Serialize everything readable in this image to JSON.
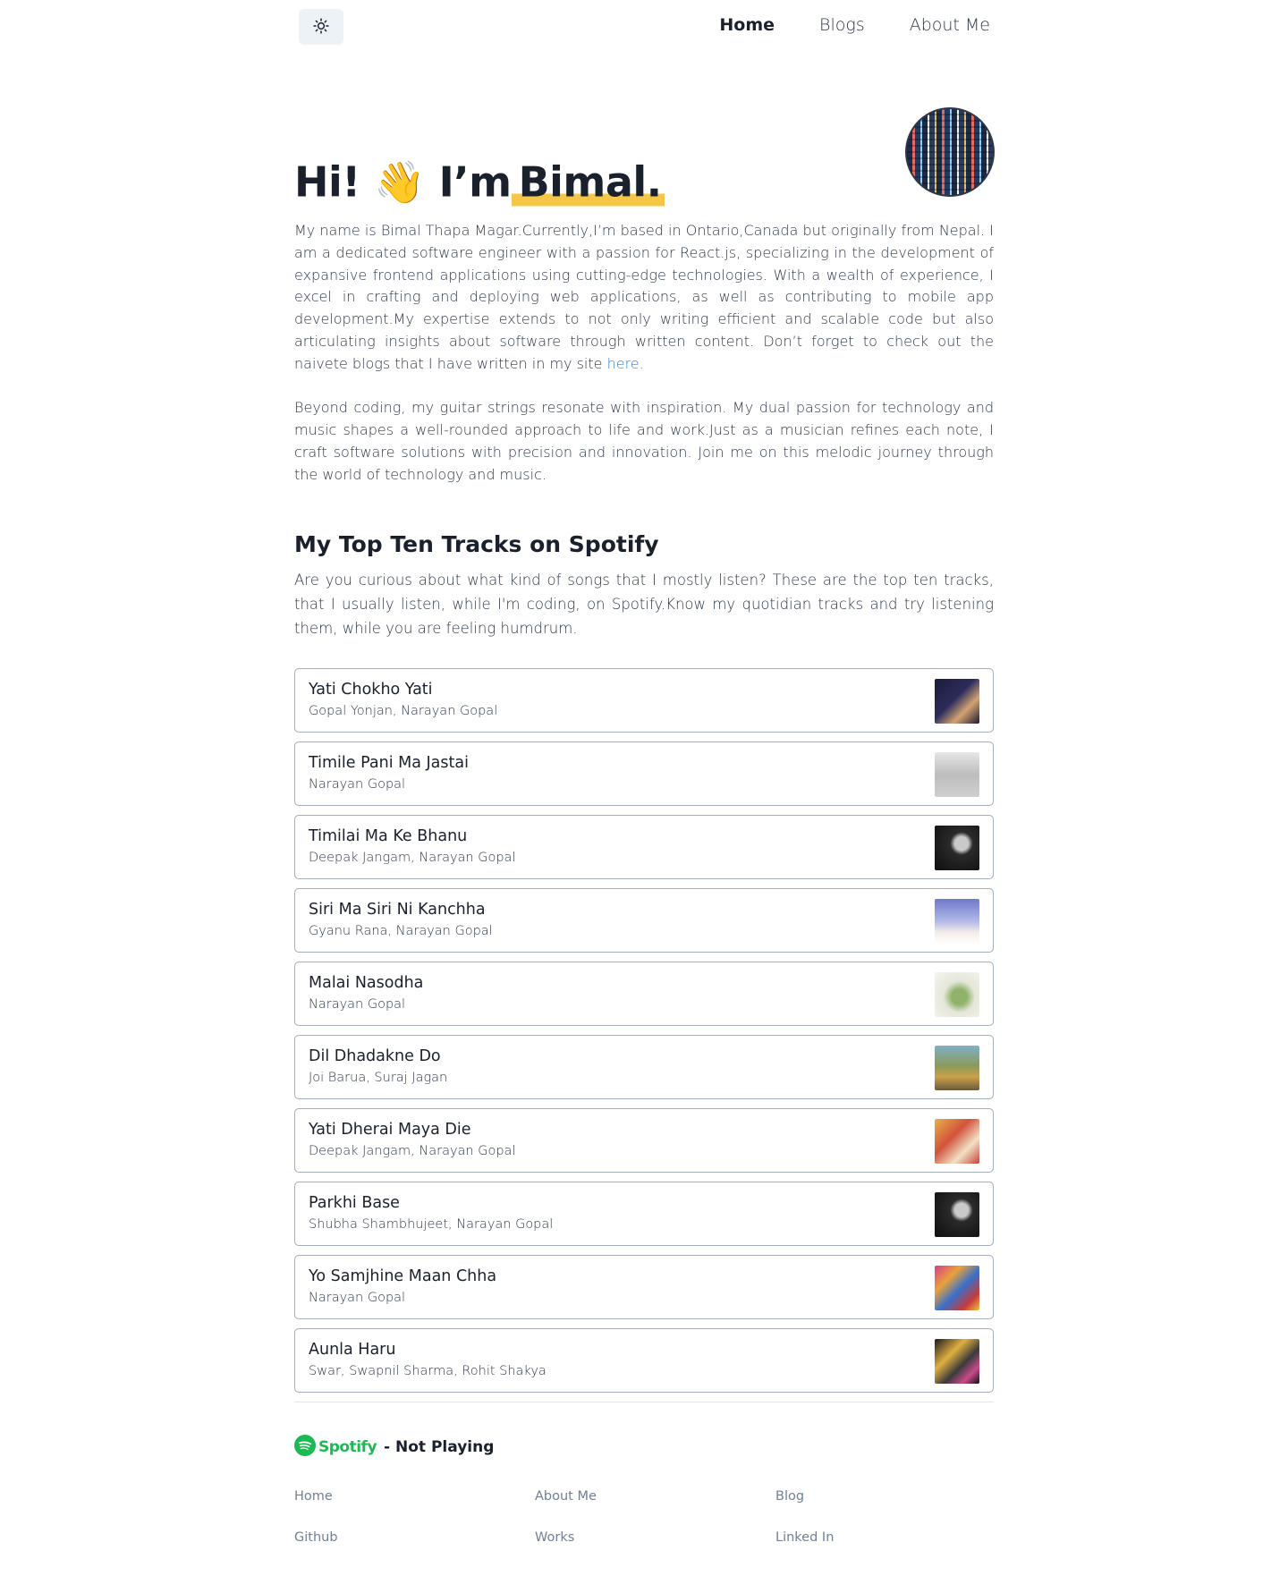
{
  "nav": {
    "theme_icon": "sun-icon",
    "links": [
      "Home",
      "Blogs",
      "About Me"
    ]
  },
  "hero": {
    "greeting": "Hi!",
    "wave": "👋",
    "im": "I’m",
    "name": "Bimal."
  },
  "about": {
    "p1_text": "My name is Bimal Thapa Magar.Currently,I’m based in Ontario,Canada but originally from Nepal. I am a dedicated software engineer with a passion for React.js, specializing in the development of expansive frontend applications using cutting-edge technologies. With a wealth of experience, I excel in crafting and deploying web applications, as well as contributing to mobile app development.My expertise extends to not only writing efficient and scalable code but also articulating insights about software through written content. Don’t forget to check out the naivete blogs that I have written in my site ",
    "p1_link": "here",
    "p1_end": ".",
    "p2": "Beyond coding, my guitar strings resonate with inspiration. My dual passion for technology and music shapes a well-rounded approach to life and work.Just as a musician refines each note, I craft software solutions with precision and innovation. Join me on this melodic journey through the world of technology and music."
  },
  "spotify_section": {
    "title": "My Top Ten Tracks on Spotify",
    "intro": "Are you curious about what kind of songs that I mostly listen? These are the top ten tracks, that I usually listen, while I'm coding, on Spotify.Know my quotidian tracks and try listening them, while you are feeling humdrum.",
    "tracks": [
      {
        "name": "Yati Chokho Yati",
        "artist": "Gopal Yonjan, Narayan Gopal"
      },
      {
        "name": "Timile Pani Ma Jastai",
        "artist": "Narayan Gopal"
      },
      {
        "name": "Timilai Ma Ke Bhanu",
        "artist": "Deepak Jangam, Narayan Gopal"
      },
      {
        "name": "Siri Ma Siri Ni Kanchha",
        "artist": "Gyanu Rana, Narayan Gopal"
      },
      {
        "name": "Malai Nasodha",
        "artist": "Narayan Gopal"
      },
      {
        "name": "Dil Dhadakne Do",
        "artist": "Joi Barua, Suraj Jagan"
      },
      {
        "name": "Yati Dherai Maya Die",
        "artist": "Deepak Jangam, Narayan Gopal"
      },
      {
        "name": "Parkhi Base",
        "artist": "Shubha Shambhujeet, Narayan Gopal"
      },
      {
        "name": "Yo Samjhine Maan Chha",
        "artist": "Narayan Gopal"
      },
      {
        "name": "Aunla Haru",
        "artist": "Swar, Swapnil Sharma, Rohit Shakya"
      }
    ]
  },
  "now_playing": {
    "brand": "Spotify",
    "status": "- Not Playing"
  },
  "footer": {
    "links": [
      "Home",
      "About Me",
      "Blog",
      "Github",
      "Works",
      "Linked In"
    ]
  },
  "colors": {
    "highlight": "#f6c744",
    "link": "#3182ce",
    "spotify_green": "#1db954"
  }
}
